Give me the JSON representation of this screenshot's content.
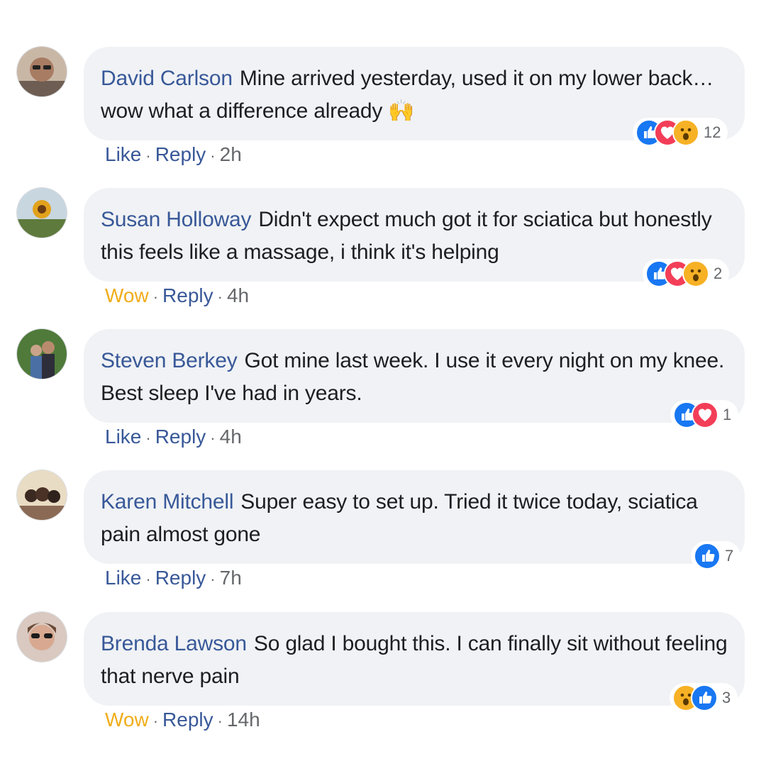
{
  "comments": [
    {
      "author": "David Carlson",
      "text": "Mine arrived yesterday, used it on my lower back… wow what a difference already 🙌",
      "action_reaction": "Like",
      "reply_label": "Reply",
      "time": "2h",
      "reaction_icons": [
        "like-icon",
        "love-icon",
        "wow-icon"
      ],
      "reaction_count": "12"
    },
    {
      "author": "Susan Holloway",
      "text": "Didn't expect much got it for sciatica but honestly this feels like a massage, i think it's helping",
      "action_reaction": "Wow",
      "reply_label": "Reply",
      "time": "4h",
      "reaction_icons": [
        "like-icon",
        "love-icon",
        "wow-icon"
      ],
      "reaction_count": "2"
    },
    {
      "author": "Steven Berkey",
      "text": "Got mine last week. I use it every night on my knee. Best sleep I've had in years.",
      "action_reaction": "Like",
      "reply_label": "Reply",
      "time": "4h",
      "reaction_icons": [
        "like-icon",
        "love-icon"
      ],
      "reaction_count": "1"
    },
    {
      "author": "Karen Mitchell",
      "text": "Super easy to set up. Tried it twice today, sciatica pain almost gone",
      "action_reaction": "Like",
      "reply_label": "Reply",
      "time": "7h",
      "reaction_icons": [
        "like-icon"
      ],
      "reaction_count": "7"
    },
    {
      "author": "Brenda Lawson",
      "text": "So glad I bought this. I can finally sit without feeling that nerve pain",
      "action_reaction": "Wow",
      "reply_label": "Reply",
      "time": "14h",
      "reaction_icons": [
        "wow-icon",
        "like-icon"
      ],
      "reaction_count": "3"
    }
  ],
  "colors": {
    "author": "#385898",
    "bubble": "#f0f2f5",
    "like": "#1877f2",
    "love": "#f33e58",
    "wow": "#f7b125",
    "wow_label": "#f0ad19"
  }
}
